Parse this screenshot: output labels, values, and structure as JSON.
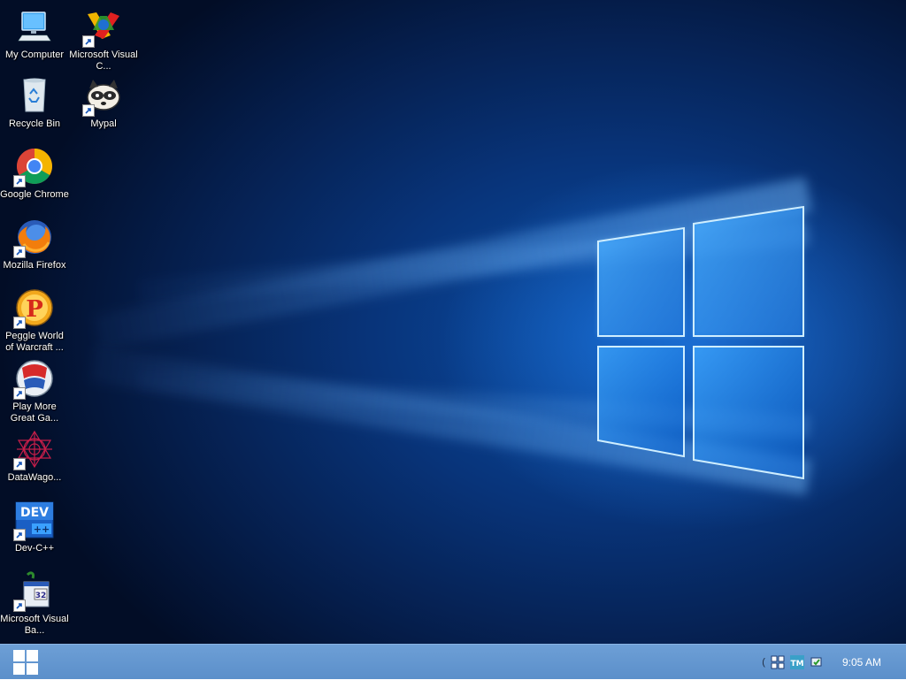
{
  "desktop": {
    "icons": [
      {
        "label": "My Computer",
        "icon": "computer-icon"
      },
      {
        "label": "Microsoft Visual C...",
        "icon": "visual-cpp-icon",
        "shortcut": true
      },
      {
        "label": "Recycle Bin",
        "icon": "recycle-bin-icon"
      },
      {
        "label": "Mypal",
        "icon": "mypal-raccoon-icon",
        "shortcut": true
      },
      {
        "label": "Google Chrome",
        "icon": "chrome-icon",
        "shortcut": true
      },
      {
        "label": "Mozilla Firefox",
        "icon": "firefox-icon",
        "shortcut": true
      },
      {
        "label": "Peggle World of Warcraft ...",
        "icon": "peggle-icon",
        "shortcut": true
      },
      {
        "label": "Play More Great Ga...",
        "icon": "popcap-icon",
        "shortcut": true
      },
      {
        "label": "DataWago...",
        "icon": "datawagon-icon",
        "shortcut": true
      },
      {
        "label": "Dev-C++",
        "icon": "devcpp-icon",
        "shortcut": true
      },
      {
        "label": "Microsoft Visual Ba...",
        "icon": "visual-basic-icon",
        "shortcut": true
      }
    ],
    "wallpaper": "windows-10-hero-wallpaper",
    "colors": {
      "bg_dark": "#051d4a",
      "bg_light": "#0b4fa8",
      "glow": "#4fb0ff"
    }
  },
  "taskbar": {
    "start_icon": "windows-logo-icon",
    "tray": {
      "chevron": "(",
      "icons": [
        "grid-app-icon",
        "tm-app-icon",
        "network-icon"
      ],
      "clock": "9:05 AM"
    },
    "color": "#5b8fca"
  }
}
